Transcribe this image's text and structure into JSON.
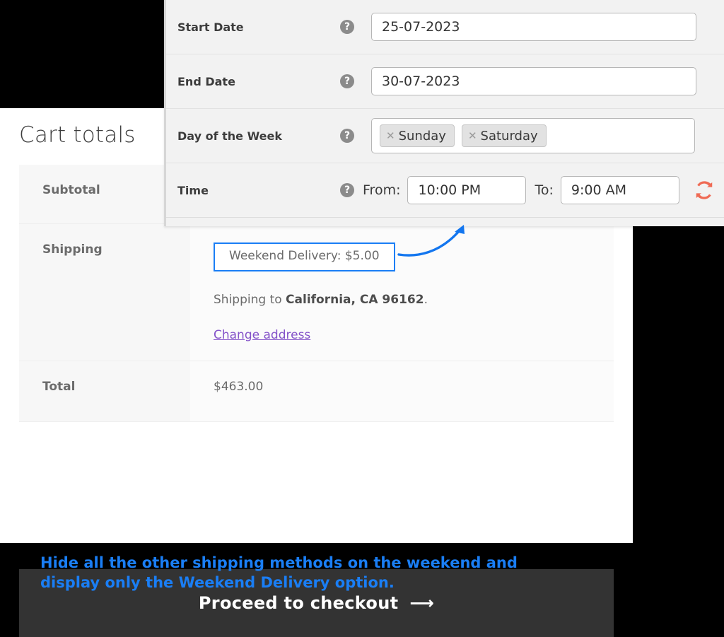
{
  "cart": {
    "title": "Cart totals",
    "rows": [
      {
        "label": "Subtotal",
        "value": ""
      },
      {
        "label": "Shipping",
        "value": ""
      },
      {
        "label": "Total",
        "value": "$463.00"
      }
    ],
    "shipping": {
      "selected_method": "Weekend Delivery: $5.00",
      "destination_prefix": "Shipping to ",
      "destination_address": "California, CA 96162",
      "destination_suffix": ".",
      "change_address_label": "Change address"
    },
    "checkout_button_label": "Proceed to checkout",
    "checkout_button_icon": "arrow-right-icon"
  },
  "settings": {
    "rows": [
      {
        "label": "Start Date",
        "help_icon": "question-mark-icon",
        "value": "25-07-2023"
      },
      {
        "label": "End Date",
        "help_icon": "question-mark-icon",
        "value": "30-07-2023"
      },
      {
        "label": "Day of the Week",
        "help_icon": "question-mark-icon",
        "tags": [
          {
            "remove_icon": "close-icon",
            "label": "Sunday"
          },
          {
            "remove_icon": "close-icon",
            "label": "Saturday"
          }
        ]
      },
      {
        "label": "Time",
        "help_icon": "question-mark-icon",
        "from_label": "From:",
        "from_value": "10:00 PM",
        "to_label": "To:",
        "to_value": "9:00 AM",
        "refresh_icon": "refresh-sync-icon"
      }
    ]
  },
  "annotation": {
    "arrow_icon": "curved-arrow-icon",
    "caption_line_1": "Hide all the other shipping methods on the weekend and",
    "caption_line_2": "display only the Weekend Delivery option."
  },
  "colors": {
    "accent_blue": "#1a7ef5",
    "link_purple": "#8453c9",
    "refresh_coral": "#ef6a54",
    "checkout_dark": "#333333",
    "background": "#000000"
  }
}
